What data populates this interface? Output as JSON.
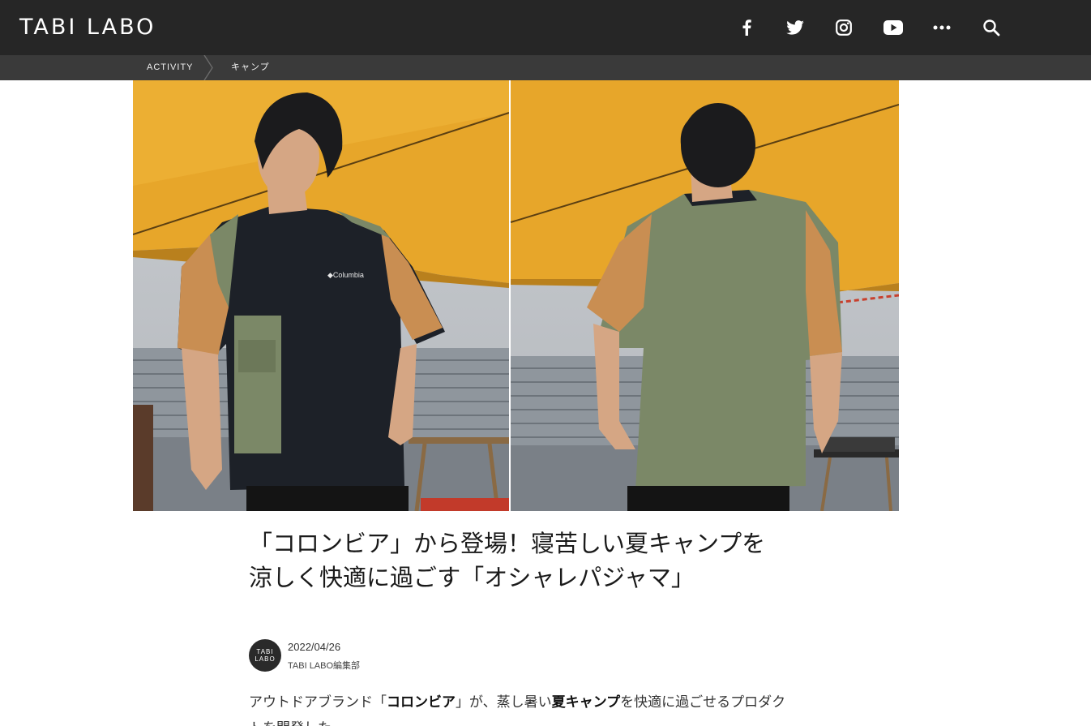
{
  "header": {
    "logo": "TABI LABO",
    "icons": [
      "facebook-icon",
      "twitter-icon",
      "instagram-icon",
      "youtube-icon",
      "more-icon",
      "search-icon"
    ]
  },
  "breadcrumb": {
    "items": [
      "ACTIVITY",
      "キャンプ"
    ]
  },
  "article": {
    "title": "「コロンビア」から登場！寝苦しい夏キャンプを涼しく快適に過ごす「オシャレパジャマ」",
    "avatar_text_line1": "TABI",
    "avatar_text_line2": "LABO",
    "date": "2022/04/26",
    "author": "TABI LABO編集部",
    "lead_parts": [
      "アウトドアブランド「",
      "コロンビア",
      "」が、蒸し暑い",
      "夏キャンプ",
      "を快適に過ごせるプロダクトを開発した。"
    ]
  },
  "colors": {
    "header_bg": "#262626",
    "subbar_bg": "#3a3a3a",
    "tarp_yellow": "#e7a62a",
    "shirt_black": "#1d2128",
    "shirt_khaki": "#7b8867",
    "sleeve_tan": "#c98e52"
  }
}
